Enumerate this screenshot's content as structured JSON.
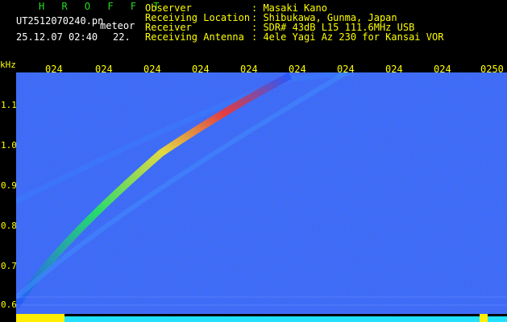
{
  "app": {
    "title": "H R O F F T",
    "file_name": "UT2512070240.pn",
    "mode": "meteor",
    "date_time": "25.12.07 02:40",
    "frame": "22."
  },
  "info": {
    "observer_label": "Observer",
    "observer_value": ": Masaki Kano",
    "location_label": "Receiving Location",
    "location_value": ": Shibukawa, Gunma, Japan",
    "receiver_label": "Receiver",
    "receiver_value": ": SDR# 43dB L15 111.6MHz USB",
    "antenna_label": "Receiving Antenna",
    "antenna_value": ": 4ele Yagi Az 230 for Kansai VOR"
  },
  "axis": {
    "unit": "kHz",
    "time_ticks": [
      "024",
      "024",
      "024",
      "024",
      "024",
      "024",
      "024",
      "024",
      "024",
      "0250"
    ],
    "freq_ticks": [
      "1.1",
      "1.0",
      "0.9",
      "0.8",
      "0.7",
      "0.6"
    ]
  },
  "colors": {
    "background": "#000000",
    "text_yellow": "#ffff00",
    "title_green": "#22dd22",
    "noise_blue": "#0a2a8a",
    "level_cyan": "#22e0ff"
  }
}
